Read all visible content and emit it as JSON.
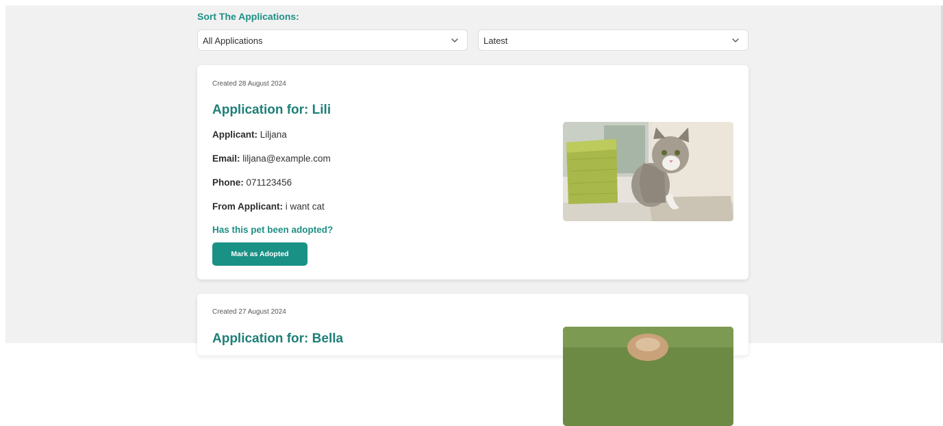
{
  "sort": {
    "title": "Sort The Applications:",
    "filter_value": "All Applications",
    "order_value": "Latest"
  },
  "applications": [
    {
      "created": "Created 28 August 2024",
      "title": "Application for: Lili",
      "applicant_label": "Applicant:",
      "applicant": "Liljana",
      "email_label": "Email:",
      "email": "liljana@example.com",
      "phone_label": "Phone:",
      "phone": "071123456",
      "message_label": "From Applicant:",
      "message": "i want cat",
      "adopted_question": "Has this pet been adopted?",
      "adopt_button": "Mark as Adopted"
    },
    {
      "created": "Created 27 August 2024",
      "title": "Application for: Bella"
    }
  ],
  "colors": {
    "accent": "#1a9185",
    "title": "#1e7f77",
    "background": "#f1f1f2"
  },
  "icons": {
    "select_chevron": "chevron-down-icon"
  }
}
